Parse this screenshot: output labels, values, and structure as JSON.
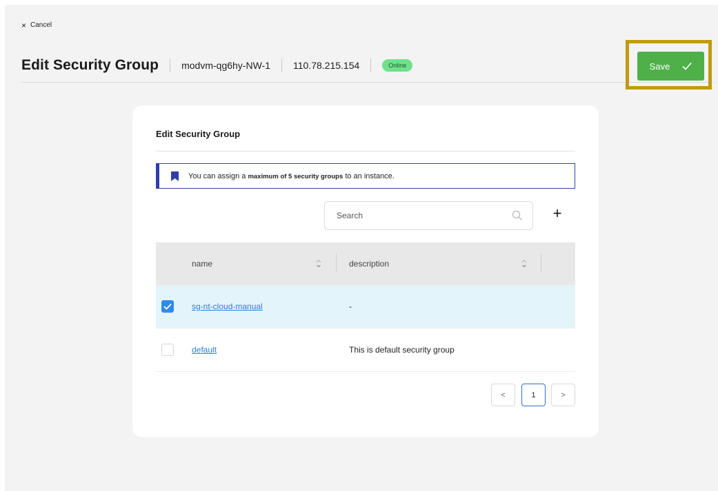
{
  "cancel": {
    "icon": "close-icon",
    "label": "Cancel"
  },
  "header": {
    "title": "Edit Security Group",
    "instance_name": "modvm-qg6hy-NW-1",
    "ip": "110.78.215.154",
    "status": "Online",
    "status_color": "#6fe08c"
  },
  "save": {
    "label": "Save",
    "icon": "check-icon",
    "color": "#4fb04a",
    "highlight_color": "#c19b0d"
  },
  "card": {
    "title": "Edit Security Group",
    "notice": {
      "icon": "bookmark-icon",
      "prefix": "You can assign a",
      "bold": "maximum of 5 security groups",
      "suffix": "to an instance."
    },
    "search": {
      "placeholder": "Search",
      "value": "",
      "icon": "search-icon"
    },
    "add": {
      "icon": "plus-icon",
      "label": "+"
    },
    "table": {
      "columns": [
        "name",
        "description"
      ],
      "rows": [
        {
          "checked": true,
          "name": "sg-nt-cloud-manual",
          "description": "-"
        },
        {
          "checked": false,
          "name": "default",
          "description": "This is default security group"
        }
      ]
    },
    "pagination": {
      "prev": "<",
      "current": "1",
      "next": ">"
    }
  }
}
